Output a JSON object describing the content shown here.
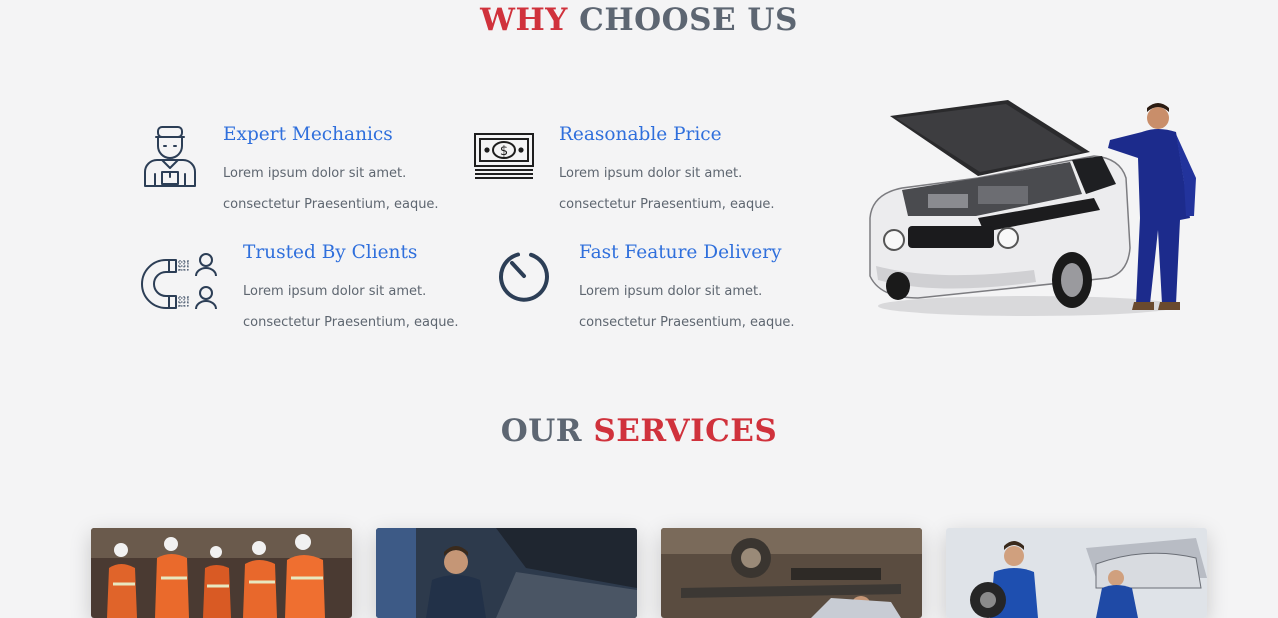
{
  "why_section": {
    "title_accent": "WHY",
    "title_rest": "CHOOSE US"
  },
  "features": [
    {
      "title": "Expert Mechanics",
      "line1": "Lorem ipsum dolor sit amet.",
      "line2": "consectetur Praesentium, eaque.",
      "icon": "mechanic-icon"
    },
    {
      "title": "Reasonable Price",
      "line1": "Lorem ipsum dolor sit amet.",
      "line2": "consectetur Praesentium, eaque.",
      "icon": "money-icon"
    },
    {
      "title": "Trusted By Clients",
      "line1": "Lorem ipsum dolor sit amet.",
      "line2": "consectetur Praesentium, eaque.",
      "icon": "magnet-clients-icon"
    },
    {
      "title": "Fast Feature Delivery",
      "line1": "Lorem ipsum dolor sit amet.",
      "line2": "consectetur Praesentium, eaque.",
      "icon": "timer-icon"
    }
  ],
  "services_section": {
    "title_rest": "OUR",
    "title_accent": "SERVICES"
  },
  "service_cards": [
    {
      "image": "workers-in-safety-vests"
    },
    {
      "image": "mechanic-at-car-hood"
    },
    {
      "image": "car-undercarriage"
    },
    {
      "image": "mechanics-with-tire"
    }
  ],
  "colors": {
    "accent_red": "#d0323c",
    "heading_gray": "#5d6672",
    "feature_blue": "#2f6fdc",
    "icon_navy": "#2c3e56",
    "background": "#f4f4f5"
  }
}
